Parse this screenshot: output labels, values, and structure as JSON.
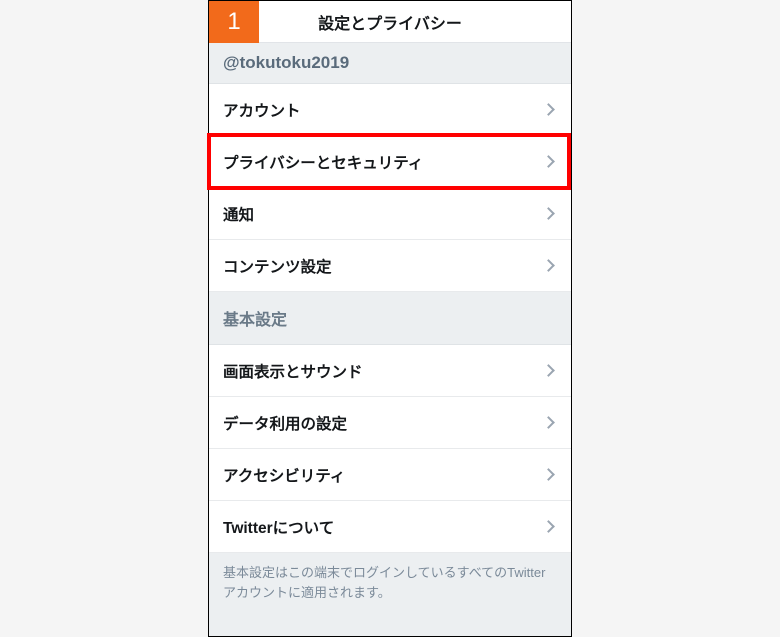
{
  "step_number": "1",
  "header": {
    "title": "設定とプライバシー"
  },
  "account_handle": "@tokutoku2019",
  "section1": {
    "items": [
      {
        "label": "アカウント"
      },
      {
        "label": "プライバシーとセキュリティ",
        "highlighted": true
      },
      {
        "label": "通知"
      },
      {
        "label": "コンテンツ設定"
      }
    ]
  },
  "section2": {
    "title": "基本設定",
    "items": [
      {
        "label": "画面表示とサウンド"
      },
      {
        "label": "データ利用の設定"
      },
      {
        "label": "アクセシビリティ"
      },
      {
        "label": "Twitterについて"
      }
    ]
  },
  "footer_note": "基本設定はこの端末でログインしているすべてのTwitterアカウントに適用されます。"
}
